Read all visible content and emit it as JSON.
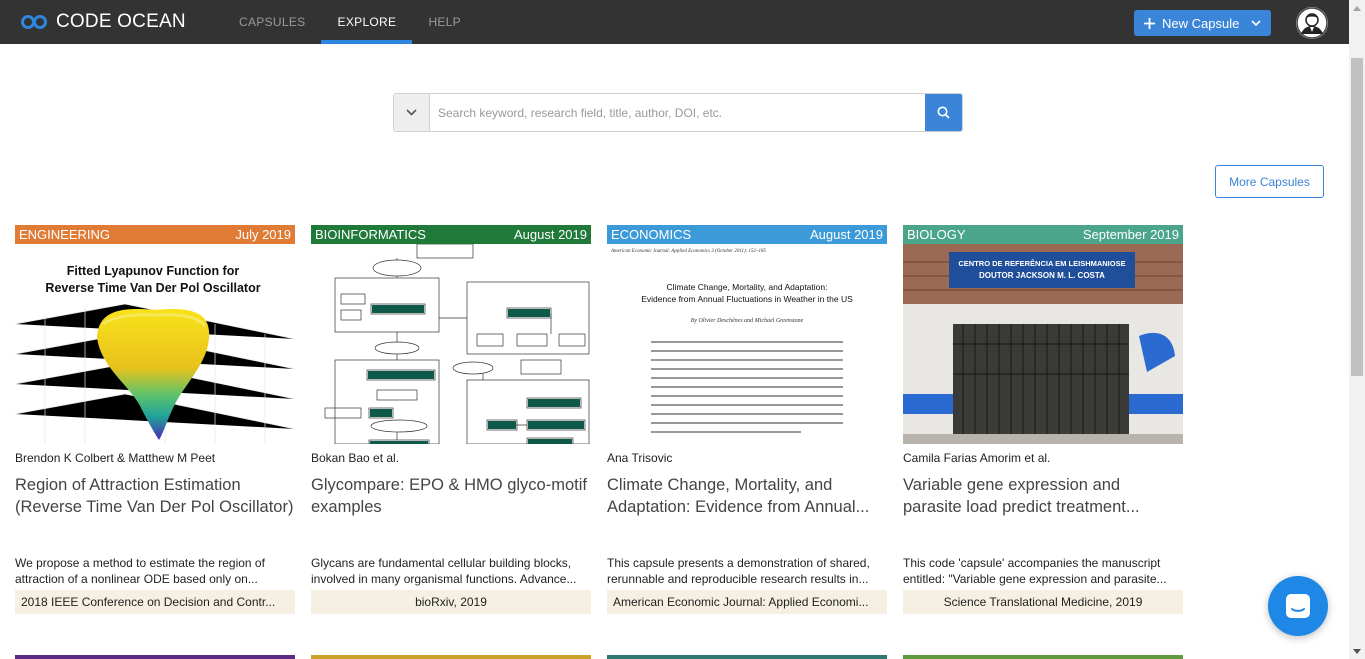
{
  "app": {
    "logo_text": "CODE OCEAN",
    "accent": "#3a85d8"
  },
  "nav": {
    "items": [
      {
        "label": "CAPSULES",
        "active": false
      },
      {
        "label": "EXPLORE",
        "active": true
      },
      {
        "label": "HELP",
        "active": false
      }
    ]
  },
  "header": {
    "new_capsule_label": "New Capsule"
  },
  "search": {
    "placeholder": "Search keyword, research field, title, author, DOI, etc."
  },
  "more_capsules_label": "More Capsules",
  "cards": [
    {
      "category": "ENGINEERING",
      "date": "July 2019",
      "color": "#e07b36",
      "image_caption_line1": "Fitted Lyapunov Function for",
      "image_caption_line2": "Reverse Time Van Der Pol Oscillator",
      "authors": "Brendon K Colbert & Matthew M Peet",
      "title": "Region of Attraction Estimation (Reverse Time Van Der Pol Oscillator)",
      "description": "We propose a method to estimate the region of attraction of a nonlinear ODE based only on...",
      "publication": "2018 IEEE Conference on Decision and Contr..."
    },
    {
      "category": "BIOINFORMATICS",
      "date": "August 2019",
      "color": "#1f7a3a",
      "authors": "Bokan Bao et al.",
      "title": "Glycompare: EPO & HMO glyco-motif examples",
      "description": "Glycans are fundamental cellular building blocks, involved in many organismal functions. Advance...",
      "publication": "bioRxiv, 2019"
    },
    {
      "category": "ECONOMICS",
      "date": "August 2019",
      "color": "#3d9ad8",
      "paper_header": "American Economic Journal: Applied Economics 3 (October 2011): 152–185",
      "paper_title_line1": "Climate Change, Mortality, and Adaptation:",
      "paper_title_line2": "Evidence from Annual Fluctuations in Weather in the US",
      "paper_authors": "By Olivier Deschênes and Michael Greenstone",
      "authors": "Ana Trisovic",
      "title": "Climate Change, Mortality, and Adaptation: Evidence from Annual...",
      "description": "This capsule presents a demonstration of shared, rerunnable and reproducible research results in...",
      "publication": "American Economic Journal: Applied Economi..."
    },
    {
      "category": "BIOLOGY",
      "date": "September 2019",
      "color": "#4aa58a",
      "sign_line1": "CENTRO DE REFERÊNCIA EM LEISHMANIOSE",
      "sign_line2": "DOUTOR JACKSON M. L. COSTA",
      "authors": "Camila Farias Amorim et al.",
      "title": "Variable gene expression and parasite load predict treatment...",
      "description": "This code 'capsule' accompanies the manuscript entitled: \"Variable gene expression and parasite...",
      "publication": "Science Translational Medicine, 2019"
    }
  ],
  "row2_colors": [
    "#5b2a86",
    "#c9a227",
    "#2c7a6f",
    "#5f9b3c"
  ]
}
